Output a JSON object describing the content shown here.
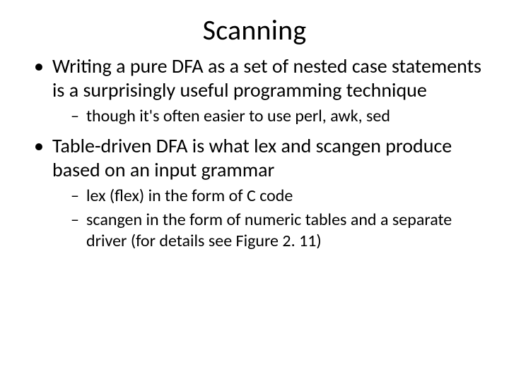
{
  "title": "Scanning",
  "bullets": [
    {
      "text": "Writing a pure DFA as a set of nested case statements is a surprisingly useful programming technique",
      "sub": [
        "though it's often easier to use perl, awk, sed"
      ]
    },
    {
      "text": "Table-driven DFA is what lex and scangen produce based on an input grammar",
      "sub": [
        "lex (flex) in the form of C code",
        "scangen in the form of numeric tables and a separate driver (for details see Figure 2. 11)"
      ]
    }
  ]
}
